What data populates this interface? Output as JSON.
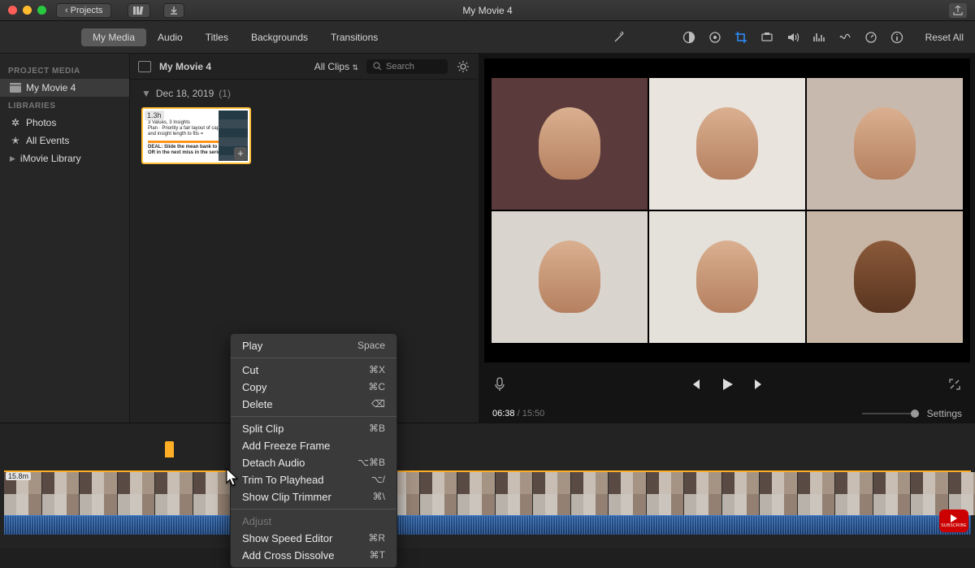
{
  "titlebar": {
    "back_label": "Projects",
    "title": "My Movie 4"
  },
  "media_tabs": [
    "My Media",
    "Audio",
    "Titles",
    "Backgrounds",
    "Transitions"
  ],
  "media_tab_selected": 0,
  "right_tools": {
    "reset_label": "Reset All",
    "icons": [
      "wand-icon",
      "color-balance-icon",
      "color-wheel-icon",
      "crop-icon",
      "stabilize-icon",
      "volume-icon",
      "equalizer-icon",
      "noise-icon",
      "speed-icon",
      "info-icon"
    ]
  },
  "sidebar": {
    "sections": [
      {
        "heading": "PROJECT MEDIA",
        "items": [
          {
            "label": "My Movie 4",
            "icon": "clapperboard-icon",
            "selected": true
          }
        ]
      },
      {
        "heading": "LIBRARIES",
        "items": [
          {
            "label": "Photos",
            "icon": "flower-icon"
          },
          {
            "label": "All Events",
            "icon": "star-icon"
          },
          {
            "label": "iMovie Library",
            "icon": "disclosure-icon",
            "disclosure": true
          }
        ]
      }
    ]
  },
  "browser": {
    "project_name": "My Movie 4",
    "filter_label": "All Clips",
    "search_placeholder": "Search",
    "date_group": "Dec 18, 2019",
    "date_count": "(1)",
    "clip_duration": "1.3h"
  },
  "viewer": {
    "current_time": "06:38",
    "total_time": "15:50",
    "settings_label": "Settings"
  },
  "timeline": {
    "strip_duration": "15.8m"
  },
  "context_menu": {
    "groups": [
      [
        {
          "label": "Play",
          "shortcut": "Space"
        }
      ],
      [
        {
          "label": "Cut",
          "shortcut": "⌘X"
        },
        {
          "label": "Copy",
          "shortcut": "⌘C"
        },
        {
          "label": "Delete",
          "shortcut": "⌫"
        }
      ],
      [
        {
          "label": "Split Clip",
          "shortcut": "⌘B"
        },
        {
          "label": "Add Freeze Frame",
          "shortcut": ""
        },
        {
          "label": "Detach Audio",
          "shortcut": "⌥⌘B"
        },
        {
          "label": "Trim To Playhead",
          "shortcut": "⌥/"
        },
        {
          "label": "Show Clip Trimmer",
          "shortcut": "⌘\\"
        }
      ],
      [
        {
          "label": "Adjust",
          "shortcut": "",
          "disabled": true
        },
        {
          "label": "Show Speed Editor",
          "shortcut": "⌘R"
        },
        {
          "label": "Add Cross Dissolve",
          "shortcut": "⌘T"
        }
      ]
    ]
  },
  "youtube_badge": "SUBSCRIBE"
}
